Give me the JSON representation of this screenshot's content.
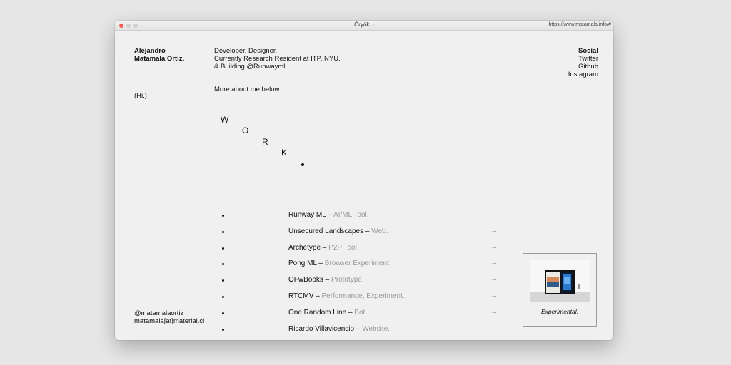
{
  "window": {
    "title": "Ōryōki",
    "title_marker": "◦",
    "url": "https://www.matamala.info/#"
  },
  "profile": {
    "name_line1": "Alejandro",
    "name_line2": "Matamala Ortiz.",
    "greeting": "(Hi.)",
    "handle": "@matamalaortiz",
    "email": "matamala[at]material.cl"
  },
  "intro": {
    "line1": "Developer. Designer.",
    "line2": "Currently Research Resident at ITP, NYU.",
    "line3": "& Building @Runwayml.",
    "more": "More about me below."
  },
  "social": {
    "heading": "Social",
    "links": [
      "Twitter",
      "Github",
      "Instagram"
    ]
  },
  "work_heading": {
    "letters": [
      "W",
      "O",
      "R",
      "K"
    ]
  },
  "projects": [
    {
      "name": "Runway ML",
      "sep": " – ",
      "type": "AI/ML Tool.",
      "arrow": "→"
    },
    {
      "name": "Unsecured Landscapes",
      "sep": " – ",
      "type": "Web.",
      "arrow": "→"
    },
    {
      "name": "Archetype",
      "sep": " – ",
      "type": "P2P Tool.",
      "arrow": "→"
    },
    {
      "name": "Pong ML",
      "sep": " – ",
      "type": "Browser Experiment.",
      "arrow": "→"
    },
    {
      "name": "OFwBooks",
      "sep": " – ",
      "type": "Prototype.",
      "arrow": "→"
    },
    {
      "name": "RTCMV",
      "sep": " – ",
      "type": "Performance, Experiment.",
      "arrow": "→"
    },
    {
      "name": "One Random Line",
      "sep": " – ",
      "type": "Bot.",
      "arrow": "→"
    },
    {
      "name": "Ricardo Villavicencio",
      "sep": " – ",
      "type": "Website.",
      "arrow": "→"
    }
  ],
  "preview": {
    "caption": "Experimental."
  },
  "colors": {
    "close": "#fc5b57",
    "muted_text": "#9a9a9a",
    "page_bg": "#f0f0f0"
  }
}
